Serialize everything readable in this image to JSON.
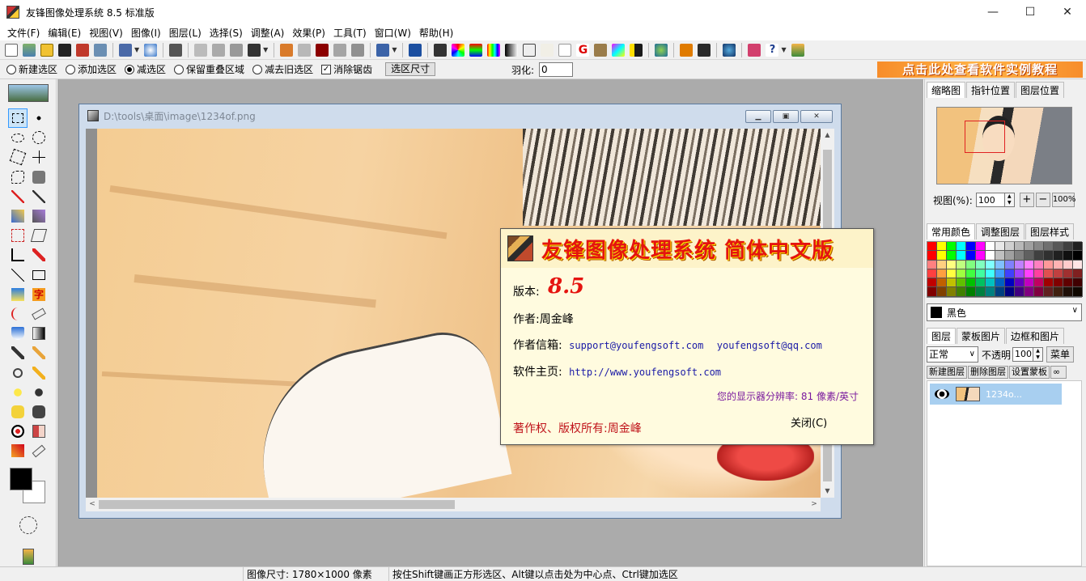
{
  "window": {
    "title": "友锋图像处理系统 8.5 标准版",
    "minimize_label": "—",
    "maximize_label": "☐",
    "close_label": "✕"
  },
  "menu": [
    "文件(F)",
    "编辑(E)",
    "视图(V)",
    "图像(I)",
    "图层(L)",
    "选择(S)",
    "调整(A)",
    "效果(P)",
    "工具(T)",
    "窗口(W)",
    "帮助(H)"
  ],
  "options_bar": {
    "modes": [
      {
        "label": "新建选区",
        "selected": false
      },
      {
        "label": "添加选区",
        "selected": false
      },
      {
        "label": "减选区",
        "selected": true
      },
      {
        "label": "保留重叠区域",
        "selected": false
      },
      {
        "label": "减去旧选区",
        "selected": false
      }
    ],
    "antialias_label": "消除锯齿",
    "antialias_checked": true,
    "size_button": "选区尺寸",
    "feather_label": "羽化:",
    "feather_value": "0",
    "tutorial_banner": "点击此处查看软件实例教程"
  },
  "document": {
    "path": "D:\\tools\\桌面\\image\\1234of.png"
  },
  "about": {
    "title": "友锋图像处理系统  简体中文版",
    "version_label": "版本:",
    "version": "8.5",
    "author_label": "作者:",
    "author": "周金峰",
    "email_label": "作者信箱:",
    "email1": "support@youfengsoft.com",
    "email2": "youfengsoft@qq.com",
    "homepage_label": "软件主页:",
    "homepage": "http://www.youfengsoft.com",
    "resolution": "您的显示器分辨率: 81 像素/英寸",
    "copyright": "著作权、版权所有:周金峰",
    "close": "关闭(C)"
  },
  "right_panel": {
    "nav_tabs": [
      "缩略图",
      "指针位置",
      "图层位置"
    ],
    "zoom_label": "视图(%):",
    "zoom_value": "100",
    "zoom_in": "+",
    "zoom_out": "−",
    "zoom_100": "100%",
    "color_tabs": [
      "常用颜色",
      "调整图层",
      "图层样式"
    ],
    "current_color": "黑色",
    "layer_tabs": [
      "图层",
      "蒙板图片",
      "边框和图片"
    ],
    "blend_mode": "正常",
    "opacity_label": "不透明",
    "opacity_value": "100",
    "menu_button": "菜单",
    "layer_buttons": [
      "新建图层",
      "删除图层",
      "设置蒙板"
    ],
    "layer_name": "1234o..."
  },
  "palette": [
    "#ff0000",
    "#ffff00",
    "#00ff00",
    "#00ffff",
    "#0000ff",
    "#ff00ff",
    "#ffffff",
    "#e8e8e8",
    "#d0d0d0",
    "#b8b8b8",
    "#a0a0a0",
    "#888888",
    "#707070",
    "#585858",
    "#404040",
    "#202020",
    "#ff0000",
    "#ffff00",
    "#00ff00",
    "#00ffff",
    "#0000ff",
    "#ff00ff",
    "#ffffff",
    "#c0c0c0",
    "#a0a0a0",
    "#808080",
    "#606060",
    "#404040",
    "#303030",
    "#202020",
    "#101010",
    "#000000",
    "#ff8080",
    "#ffd080",
    "#ffff80",
    "#c0ff80",
    "#80ff80",
    "#80ffc0",
    "#80ffff",
    "#80c0ff",
    "#8080ff",
    "#c080ff",
    "#ff80ff",
    "#ff80c0",
    "#ff9999",
    "#ffb3b3",
    "#ffcccc",
    "#ffe6e6",
    "#ff4040",
    "#ff9f40",
    "#ffff40",
    "#9fff40",
    "#40ff40",
    "#40ff9f",
    "#40ffff",
    "#409fff",
    "#4040ff",
    "#9f40ff",
    "#ff40ff",
    "#ff409f",
    "#e05050",
    "#c04040",
    "#a03030",
    "#802020",
    "#c00000",
    "#c06000",
    "#c0c000",
    "#60c000",
    "#00c000",
    "#00c060",
    "#00c0c0",
    "#0060c0",
    "#0000c0",
    "#6000c0",
    "#c000c0",
    "#c00060",
    "#a00000",
    "#800000",
    "#600000",
    "#400000",
    "#800000",
    "#804000",
    "#808000",
    "#408000",
    "#008000",
    "#008040",
    "#008080",
    "#004080",
    "#000080",
    "#400080",
    "#800080",
    "#800040",
    "#602020",
    "#402010",
    "#201008",
    "#100800"
  ],
  "status": {
    "image_size": "图像尺寸: 1780×1000 像素",
    "hint": "按住Shift键画正方形选区、Alt键以点击处为中心点、Ctrl键加选区"
  }
}
